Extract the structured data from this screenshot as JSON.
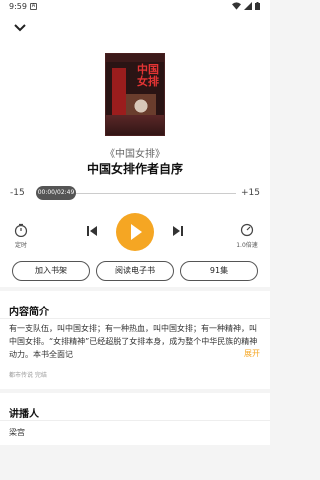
{
  "status_bar": {
    "time": "9:59",
    "app_icon": "A"
  },
  "book": {
    "title": "《中国女排》",
    "chapter": "中国女排作者自序",
    "cover_title": "中国女排"
  },
  "player": {
    "skip_back": "-15",
    "skip_forward": "+15",
    "time": "00:00/02:49",
    "progress": 0,
    "timer_label": "定时",
    "speed_label": "1.0倍速"
  },
  "actions": {
    "add_shelf": "加入书架",
    "read_ebook": "阅读电子书",
    "episodes": "91集"
  },
  "intro": {
    "heading": "内容简介",
    "text": "有一支队伍，叫中国女排；有一种热血，叫中国女排；有一种精神，叫中国女排。“女排精神”已经超脱了女排本身，成为整个中华民族的精神动力。本书全面记",
    "expand": "展开",
    "tags": "都市传说 完结"
  },
  "narrator": {
    "heading": "讲播人",
    "name": "梁宫"
  },
  "colors": {
    "accent": "#f5a623"
  }
}
